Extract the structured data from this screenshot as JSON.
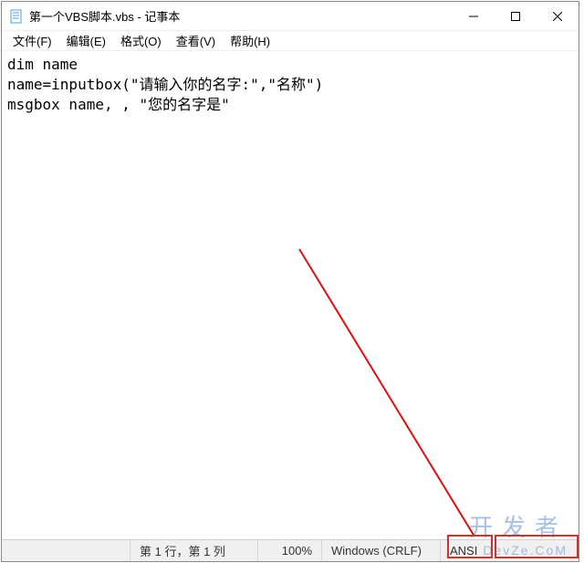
{
  "titlebar": {
    "title": "第一个VBS脚本.vbs - 记事本"
  },
  "menu": {
    "file": "文件(F)",
    "edit": "编辑(E)",
    "format": "格式(O)",
    "view": "查看(V)",
    "help": "帮助(H)"
  },
  "editor": {
    "content": "dim name\nname=inputbox(\"请输入你的名字:\",\"名称\")\nmsgbox name, , \"您的名字是\""
  },
  "status": {
    "position": "第 1 行，第 1 列",
    "zoom": "100%",
    "eol": "Windows (CRLF)",
    "encoding": "ANSI"
  },
  "watermark": "开发者",
  "watermark_sub": "DevZe.CoM"
}
